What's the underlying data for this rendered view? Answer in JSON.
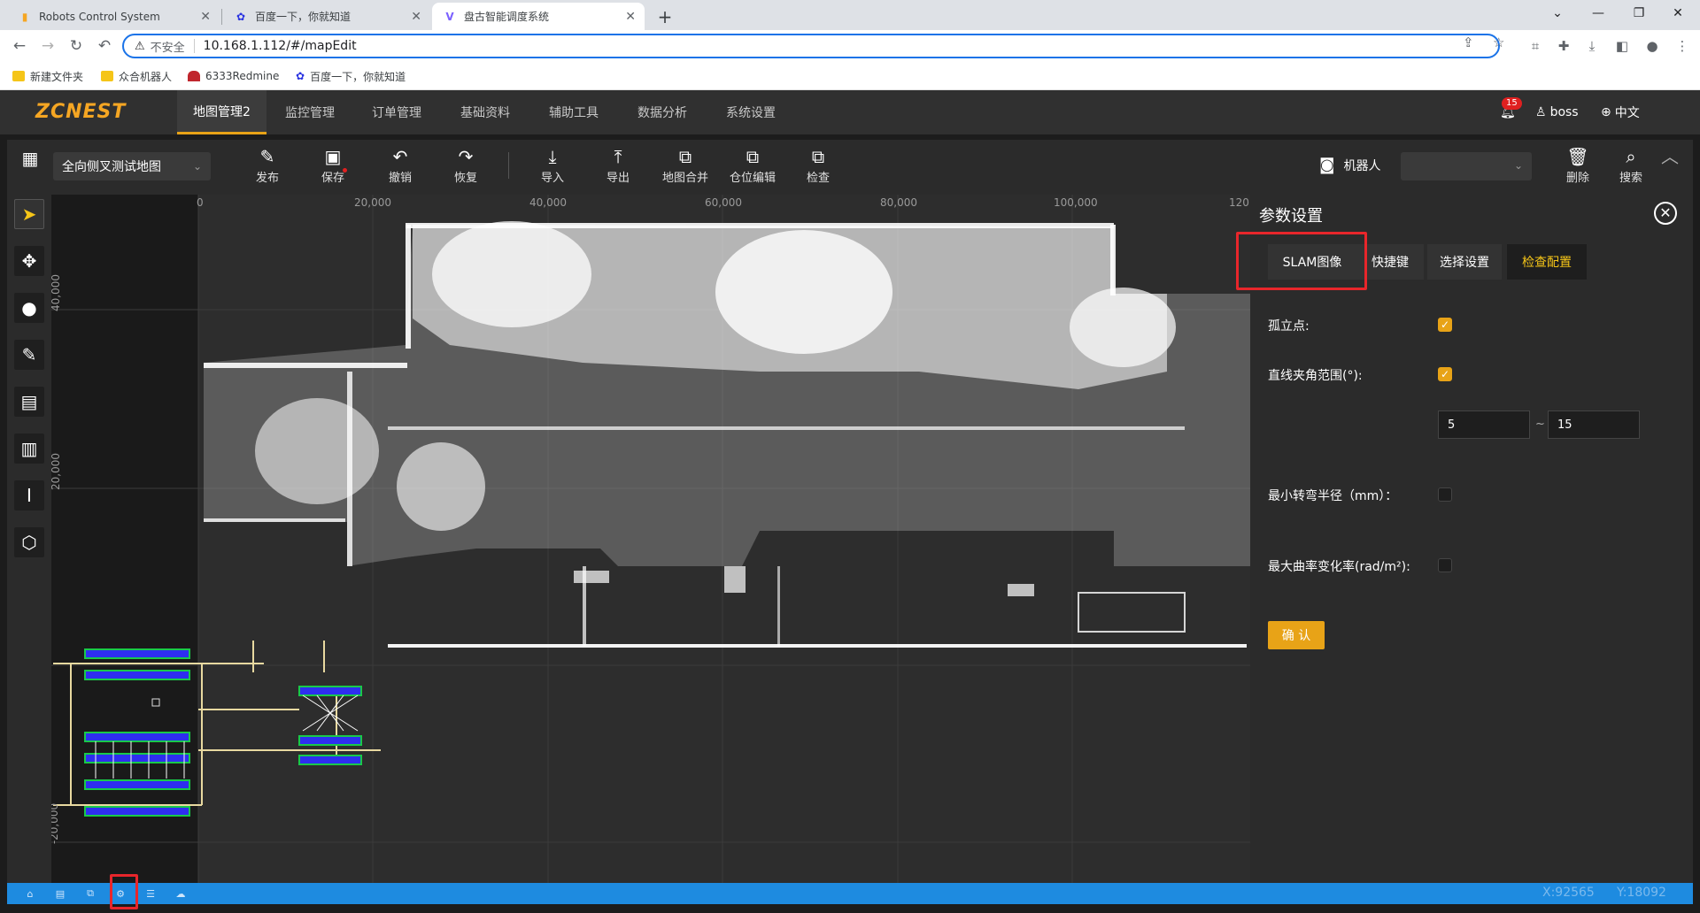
{
  "browser": {
    "tabs": [
      {
        "title": "Robots Control System"
      },
      {
        "title": "百度一下，你就知道"
      },
      {
        "title": "盘古智能调度系统"
      }
    ],
    "new_tab": "+",
    "insecure_label": "不安全",
    "url": "10.168.1.112/#/mapEdit",
    "bookmarks": [
      {
        "label": "新建文件夹"
      },
      {
        "label": "众合机器人"
      },
      {
        "label": "6333Redmine"
      },
      {
        "label": "百度一下，你就知道"
      }
    ]
  },
  "app": {
    "logo": "ZCNEST",
    "nav": [
      "地图管理2",
      "监控管理",
      "订单管理",
      "基础资料",
      "辅助工具",
      "数据分析",
      "系统设置"
    ],
    "notification_count": "15",
    "user": "boss",
    "language": "中文"
  },
  "editor": {
    "map_name": "全向侧叉测试地图",
    "tools": [
      "发布",
      "保存",
      "撤销",
      "恢复",
      "导入",
      "导出",
      "地图合并",
      "仓位编辑",
      "检查"
    ],
    "robot_label": "机器人",
    "right_tools": [
      "删除",
      "搜索"
    ],
    "ruler_x": [
      "0",
      "20,000",
      "40,000",
      "60,000",
      "80,000",
      "100,000",
      "120"
    ],
    "ruler_y": [
      "40,000",
      "20,000",
      "-20,000"
    ]
  },
  "panel": {
    "title": "参数设置",
    "tabs": [
      "SLAM图像",
      "快捷键",
      "选择设置",
      "检查配置"
    ],
    "active_tab": "检查配置",
    "fields": {
      "isolated_point": {
        "label": "孤立点:",
        "checked": true
      },
      "line_angle": {
        "label": "直线夹角范围(°):",
        "checked": true,
        "min": "5",
        "max": "15",
        "separator": "~"
      },
      "min_turn_radius": {
        "label": "最小转弯半径（mm）：",
        "checked": false
      },
      "max_curvature_rate": {
        "label": "最大曲率变化率(rad/m²):",
        "checked": false
      }
    },
    "confirm": "确 认"
  },
  "status": {
    "x": "X:92565",
    "y": "Y:18092"
  },
  "colors": {
    "accent": "#e8a317",
    "highlight_box": "#e8262b",
    "statusbar": "#1e8be0"
  }
}
